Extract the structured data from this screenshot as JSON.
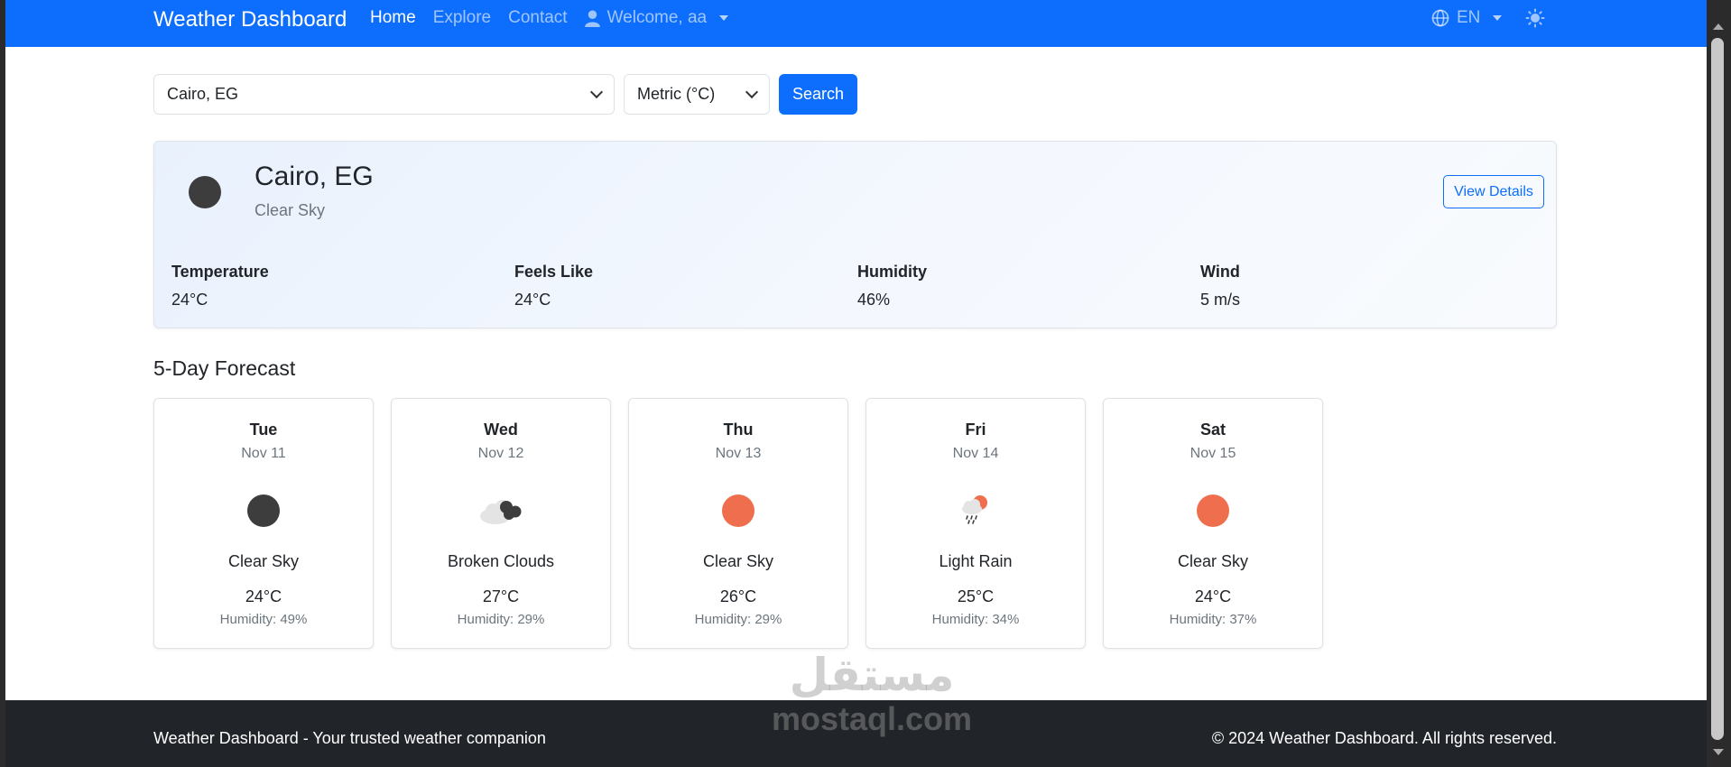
{
  "navbar": {
    "brand": "Weather Dashboard",
    "links": [
      "Home",
      "Explore",
      "Contact"
    ],
    "user_label": "Welcome, aa",
    "language": "EN"
  },
  "search": {
    "city_value": "Cairo, EG",
    "units_value": "Metric (°C)",
    "button_label": "Search"
  },
  "current": {
    "city": "Cairo, EG",
    "description": "Clear Sky",
    "details_label": "View Details",
    "metrics": [
      {
        "label": "Temperature",
        "value": "24°C"
      },
      {
        "label": "Feels Like",
        "value": "24°C"
      },
      {
        "label": "Humidity",
        "value": "46%"
      },
      {
        "label": "Wind",
        "value": "5 m/s"
      }
    ]
  },
  "forecast": {
    "title": "5-Day Forecast",
    "days": [
      {
        "day": "Tue",
        "date": "Nov 11",
        "description": "Clear Sky",
        "temp": "24°C",
        "humidity": "Humidity: 49%",
        "icon": "moon-icon"
      },
      {
        "day": "Wed",
        "date": "Nov 12",
        "description": "Broken Clouds",
        "temp": "27°C",
        "humidity": "Humidity: 29%",
        "icon": "broken-clouds-icon"
      },
      {
        "day": "Thu",
        "date": "Nov 13",
        "description": "Clear Sky",
        "temp": "26°C",
        "humidity": "Humidity: 29%",
        "icon": "sun-icon"
      },
      {
        "day": "Fri",
        "date": "Nov 14",
        "description": "Light Rain",
        "temp": "25°C",
        "humidity": "Humidity: 34%",
        "icon": "light-rain-icon"
      },
      {
        "day": "Sat",
        "date": "Nov 15",
        "description": "Clear Sky",
        "temp": "24°C",
        "humidity": "Humidity: 37%",
        "icon": "sun-icon"
      }
    ]
  },
  "footer": {
    "left": "Weather Dashboard - Your trusted weather companion",
    "right": "© 2024 Weather Dashboard. All rights reserved."
  },
  "watermark": {
    "arabic": "مستقل",
    "latin": "mostaql.com"
  },
  "colors": {
    "primary": "#0d6efd",
    "sun": "#ee6e4d",
    "moon": "#3d3d3d",
    "footer": "#212529"
  }
}
